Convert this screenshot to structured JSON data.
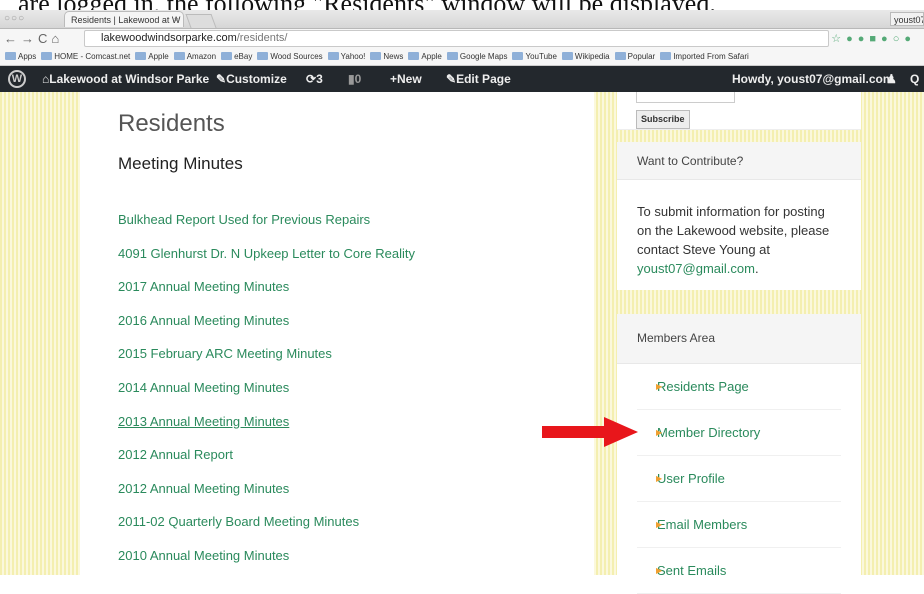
{
  "caption": "are logged in, the following \"Residents\" window will be displayed.",
  "browser": {
    "tab_title": "Residents | Lakewood at W",
    "tab_close": "×",
    "right_tab": "youst07",
    "url_host": "lakewoodwindsorparke.com",
    "url_path": "/residents/",
    "bookmarks": [
      "Apps",
      "HOME - Comcast.net",
      "Apple",
      "Amazon",
      "eBay",
      "Wood Sources",
      "Yahoo!",
      "News",
      "Apple",
      "Google Maps",
      "YouTube",
      "Wikipedia",
      "Popular",
      "Imported From Safari"
    ]
  },
  "adminbar": {
    "site": "Lakewood at Windsor Parke",
    "customize": "Customize",
    "updates": "3",
    "comments": "0",
    "new": "New",
    "edit": "Edit Page",
    "howdy": "Howdy, youst07@gmail.com"
  },
  "main": {
    "title": "Residents",
    "subtitle": "Meeting Minutes",
    "links": [
      "Bulkhead Report Used for Previous Repairs",
      "4091 Glenhurst Dr. N Upkeep Letter to Core Reality",
      "2017 Annual Meeting Minutes",
      "2016 Annual Meeting Minutes",
      "2015 February ARC Meeting Minutes",
      "2014 Annual Meeting Minutes",
      "2013 Annual Meeting Minutes",
      "2012 Annual Report",
      "2012 Annual Meeting Minutes",
      "2011-02 Quarterly Board Meeting Minutes",
      "2010 Annual Meeting Minutes"
    ]
  },
  "sidebar": {
    "subscribe": "Subscribe",
    "contribute_title": "Want to Contribute?",
    "contribute_text": "To submit information for posting on the Lakewood website, please contact Steve Young at",
    "contribute_email": "youst07@gmail.com",
    "members_title": "Members Area",
    "members_items": [
      "Residents Page",
      "Member Directory",
      "User Profile",
      "Email Members",
      "Sent Emails"
    ]
  },
  "colors": {
    "link": "#2a8a5c",
    "adminbar": "#23282d",
    "arrow": "#e8161b",
    "bullet": "#f0a030"
  }
}
